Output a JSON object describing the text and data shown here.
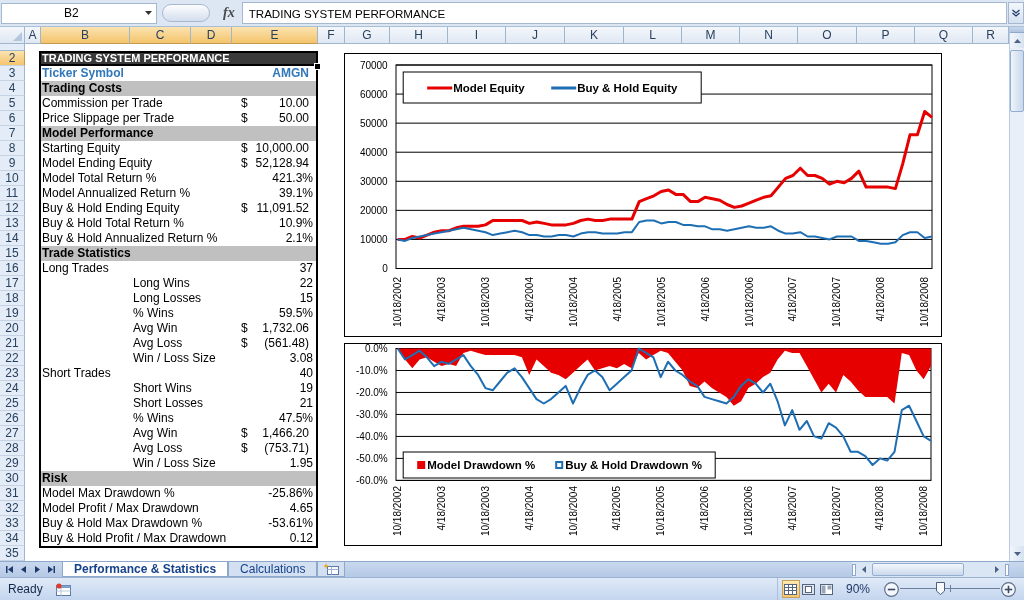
{
  "formula_bar": {
    "name_box": "B2",
    "function_button": "fx",
    "formula": "TRADING SYSTEM PERFORMANCE"
  },
  "column_headers": [
    {
      "label": "A",
      "selected": false
    },
    {
      "label": "B",
      "selected": true
    },
    {
      "label": "C",
      "selected": true
    },
    {
      "label": "D",
      "selected": true
    },
    {
      "label": "E",
      "selected": true
    },
    {
      "label": "F",
      "selected": false
    },
    {
      "label": "G",
      "selected": false
    },
    {
      "label": "H",
      "selected": false
    },
    {
      "label": "I",
      "selected": false
    },
    {
      "label": "J",
      "selected": false
    },
    {
      "label": "K",
      "selected": false
    },
    {
      "label": "L",
      "selected": false
    },
    {
      "label": "M",
      "selected": false
    },
    {
      "label": "N",
      "selected": false
    },
    {
      "label": "O",
      "selected": false
    },
    {
      "label": "P",
      "selected": false
    },
    {
      "label": "Q",
      "selected": false
    },
    {
      "label": "R",
      "selected": false
    }
  ],
  "row_headers": [
    {
      "label": "2",
      "selected": true
    },
    {
      "label": "3",
      "selected": false
    },
    {
      "label": "4",
      "selected": false
    },
    {
      "label": "5",
      "selected": false
    },
    {
      "label": "6",
      "selected": false
    },
    {
      "label": "7",
      "selected": false
    },
    {
      "label": "8",
      "selected": false
    },
    {
      "label": "9",
      "selected": false
    },
    {
      "label": "10",
      "selected": false
    },
    {
      "label": "11",
      "selected": false
    },
    {
      "label": "12",
      "selected": false
    },
    {
      "label": "13",
      "selected": false
    },
    {
      "label": "14",
      "selected": false
    },
    {
      "label": "15",
      "selected": false
    },
    {
      "label": "16",
      "selected": false
    },
    {
      "label": "17",
      "selected": false
    },
    {
      "label": "18",
      "selected": false
    },
    {
      "label": "19",
      "selected": false
    },
    {
      "label": "20",
      "selected": false
    },
    {
      "label": "21",
      "selected": false
    },
    {
      "label": "22",
      "selected": false
    },
    {
      "label": "23",
      "selected": false
    },
    {
      "label": "24",
      "selected": false
    },
    {
      "label": "25",
      "selected": false
    },
    {
      "label": "26",
      "selected": false
    },
    {
      "label": "27",
      "selected": false
    },
    {
      "label": "28",
      "selected": false
    },
    {
      "label": "29",
      "selected": false
    },
    {
      "label": "30",
      "selected": false
    },
    {
      "label": "31",
      "selected": false
    },
    {
      "label": "32",
      "selected": false
    },
    {
      "label": "33",
      "selected": false
    },
    {
      "label": "34",
      "selected": false
    },
    {
      "label": "35",
      "selected": false
    }
  ],
  "table": {
    "title": {
      "text": "TRADING SYSTEM PERFORMANCE",
      "selected": true
    },
    "rows": [
      {
        "kind": "ticker",
        "label": "Ticker Symbol",
        "value": "AMGN"
      },
      {
        "kind": "section",
        "label": "Trading Costs"
      },
      {
        "kind": "item",
        "label": "Commission per Trade",
        "currency": "$",
        "value": "10.00"
      },
      {
        "kind": "item",
        "label": "Price Slippage per Trade",
        "currency": "$",
        "value": "50.00"
      },
      {
        "kind": "section",
        "label": "Model Performance"
      },
      {
        "kind": "item",
        "label": "Starting Equity",
        "currency": "$",
        "value": "10,000.00"
      },
      {
        "kind": "item",
        "label": "Model Ending Equity",
        "currency": "$",
        "value": "52,128.94"
      },
      {
        "kind": "item",
        "label": "Model Total Return %",
        "value": "421.3%"
      },
      {
        "kind": "item",
        "label": "Model Annualized Return %",
        "value": "39.1%"
      },
      {
        "kind": "item",
        "label": "Buy & Hold Ending Equity",
        "currency": "$",
        "value": "11,091.52"
      },
      {
        "kind": "item",
        "label": "Buy & Hold Total Return %",
        "value": "10.9%"
      },
      {
        "kind": "item",
        "label": "Buy & Hold Annualized Return %",
        "value": "2.1%"
      },
      {
        "kind": "section",
        "label": "Trade Statistics"
      },
      {
        "kind": "item",
        "label": "Long Trades",
        "value": "37",
        "children": [
          {
            "kind": "item",
            "label": "Long Wins",
            "value": "22"
          },
          {
            "kind": "item",
            "label": "Long Losses",
            "value": "15"
          },
          {
            "kind": "item",
            "label": "% Wins",
            "value": "59.5%"
          },
          {
            "kind": "item",
            "label": "Avg Win",
            "currency": "$",
            "value": "1,732.06"
          },
          {
            "kind": "item",
            "label": "Avg Loss",
            "currency": "$",
            "value": "(561.48)"
          },
          {
            "kind": "item",
            "label": "Win / Loss Size",
            "value": "3.08"
          }
        ]
      },
      {
        "kind": "item",
        "label": "Short Trades",
        "value": "40",
        "children": [
          {
            "kind": "item",
            "label": "Short Wins",
            "value": "19"
          },
          {
            "kind": "item",
            "label": "Short Losses",
            "value": "21"
          },
          {
            "kind": "item",
            "label": "% Wins",
            "value": "47.5%"
          },
          {
            "kind": "item",
            "label": "Avg Win",
            "currency": "$",
            "value": "1,466.20"
          },
          {
            "kind": "item",
            "label": "Avg Loss",
            "currency": "$",
            "value": "(753.71)"
          },
          {
            "kind": "item",
            "label": "Win / Loss Size",
            "value": "1.95"
          }
        ]
      },
      {
        "kind": "section",
        "label": "Risk"
      },
      {
        "kind": "item",
        "label": "Model Max Drawdown %",
        "value": "-25.86%"
      },
      {
        "kind": "item",
        "label": "Model Profit / Max Drawdown",
        "value": "4.65"
      },
      {
        "kind": "item",
        "label": "Buy & Hold Max Drawdown %",
        "value": "-53.61%"
      },
      {
        "kind": "item",
        "label": "Buy & Hold Profit / Max Drawdown",
        "value": "0.12"
      }
    ]
  },
  "charts": [
    {
      "chart_data": {
        "type": "line",
        "categories": [
          "10/18/2002",
          null,
          null,
          null,
          null,
          null,
          "4/18/2003",
          null,
          null,
          null,
          null,
          null,
          "10/18/2003",
          null,
          null,
          null,
          null,
          null,
          "4/18/2004",
          null,
          null,
          null,
          null,
          null,
          "10/18/2004",
          null,
          null,
          null,
          null,
          null,
          "4/18/2005",
          null,
          null,
          null,
          null,
          null,
          "10/18/2005",
          null,
          null,
          null,
          null,
          null,
          "4/18/2006",
          null,
          null,
          null,
          null,
          null,
          "10/18/2006",
          null,
          null,
          null,
          null,
          null,
          "4/18/2007",
          null,
          null,
          null,
          null,
          null,
          "10/18/2007",
          null,
          null,
          null,
          null,
          null,
          "4/18/2008",
          null,
          null,
          null,
          null,
          null,
          "10/18/2008",
          null
        ],
        "series": [
          {
            "name": "Model Equity",
            "color": "#e60000",
            "values": [
              10000,
              10000,
              11000,
              10500,
              11500,
              12500,
              13000,
              13000,
              14000,
              14500,
              14500,
              14500,
              15000,
              16500,
              16500,
              16500,
              16500,
              16500,
              15500,
              16000,
              15500,
              15000,
              15000,
              15000,
              15500,
              16500,
              17000,
              16500,
              16500,
              17000,
              17000,
              17000,
              17000,
              23000,
              24000,
              25000,
              26500,
              27000,
              25500,
              25500,
              23000,
              23000,
              24500,
              24000,
              23500,
              22000,
              21000,
              21500,
              22500,
              23500,
              24500,
              25000,
              28000,
              31000,
              32000,
              34500,
              32000,
              32000,
              31000,
              29000,
              30000,
              29500,
              31000,
              33500,
              28000,
              28000,
              28000,
              28000,
              27500,
              36000,
              46000,
              46000,
              54000,
              52000
            ]
          },
          {
            "name": "Buy & Hold Equity",
            "color": "#1e6eb4",
            "values": [
              10000,
              9500,
              10500,
              11000,
              11500,
              12000,
              12500,
              13000,
              13500,
              14000,
              13500,
              13000,
              12500,
              11500,
              12000,
              12500,
              13000,
              12500,
              11500,
              11500,
              11000,
              11000,
              11500,
              11500,
              11000,
              12000,
              12500,
              12500,
              12000,
              12000,
              12000,
              12500,
              12500,
              16000,
              16500,
              16500,
              15500,
              16000,
              16000,
              15000,
              15000,
              14500,
              14500,
              13500,
              13500,
              13000,
              13500,
              14000,
              14500,
              14000,
              14000,
              14500,
              13000,
              12000,
              12000,
              12500,
              11000,
              11000,
              10500,
              10000,
              11000,
              11000,
              11000,
              9500,
              9500,
              9000,
              8500,
              8500,
              9000,
              11500,
              12500,
              12500,
              10500,
              11000
            ]
          }
        ],
        "ylim": [
          0,
          70000
        ],
        "yticks": [
          0,
          10000,
          20000,
          30000,
          40000,
          50000,
          60000,
          70000
        ],
        "grid": true,
        "legend": "top-left"
      }
    },
    {
      "chart_data": {
        "type": "area",
        "categories": [
          "10/18/2002",
          null,
          null,
          null,
          null,
          null,
          "4/18/2003",
          null,
          null,
          null,
          null,
          null,
          "10/18/2003",
          null,
          null,
          null,
          null,
          null,
          "4/18/2004",
          null,
          null,
          null,
          null,
          null,
          "10/18/2004",
          null,
          null,
          null,
          null,
          null,
          "4/18/2005",
          null,
          null,
          null,
          null,
          null,
          "10/18/2005",
          null,
          null,
          null,
          null,
          null,
          "4/18/2006",
          null,
          null,
          null,
          null,
          null,
          "10/18/2006",
          null,
          null,
          null,
          null,
          null,
          "4/18/2007",
          null,
          null,
          null,
          null,
          null,
          "10/18/2007",
          null,
          null,
          null,
          null,
          null,
          "4/18/2008",
          null,
          null,
          null,
          null,
          null,
          "10/18/2008",
          null
        ],
        "series": [
          {
            "name": "Model Drawdown %",
            "color": "#e60000",
            "type": "area",
            "values": [
              0,
              -5,
              -9,
              -5,
              -4,
              -6,
              -8,
              -7,
              -8,
              -2,
              -1,
              -2,
              -3,
              -3,
              -3,
              -3,
              -3,
              -4,
              -12,
              -5,
              -8,
              -11,
              -12,
              -14,
              -11,
              -8,
              -5,
              -10,
              -9,
              -8,
              -9,
              -7,
              -9,
              -2,
              -5,
              -3,
              -1,
              -2,
              -6,
              -10,
              -17,
              -18,
              -15,
              -18,
              -20,
              -22,
              -26,
              -24,
              -18,
              -16,
              -13,
              -11,
              -5,
              -1,
              -2,
              -2,
              -8,
              -14,
              -20,
              -16,
              -20,
              -12,
              -15,
              -19,
              -22,
              -22,
              -22,
              -22,
              -25,
              -2,
              -3,
              -10,
              -14,
              -8
            ]
          },
          {
            "name": "Buy & Hold Drawdown %",
            "color": "#1e6eb4",
            "type": "line",
            "values": [
              0,
              -5,
              -3,
              -1,
              -4,
              -8,
              -6,
              -7,
              -5,
              -3,
              -8,
              -12,
              -18,
              -19,
              -15,
              -11,
              -9,
              -13,
              -18,
              -23,
              -25,
              -23,
              -20,
              -17,
              -25,
              -18,
              -12,
              -10,
              -13,
              -19,
              -16,
              -13,
              -10,
              0,
              -2,
              -4,
              -13,
              -6,
              -10,
              -12,
              -15,
              -17,
              -22,
              -23,
              -24,
              -25,
              -22,
              -17,
              -14,
              -16,
              -20,
              -16,
              -24,
              -35,
              -28,
              -37,
              -33,
              -40,
              -41,
              -34,
              -36,
              -40,
              -47,
              -47,
              -49,
              -53,
              -50,
              -51,
              -47,
              -28,
              -26,
              -33,
              -40,
              -42
            ]
          }
        ],
        "ylim": [
          -60,
          0
        ],
        "yticks": [
          {
            "value": 0,
            "label": "0.0%"
          },
          {
            "value": -10,
            "label": "-10.0%"
          },
          {
            "value": -20,
            "label": "-20.0%"
          },
          {
            "value": -30,
            "label": "-30.0%"
          },
          {
            "value": -40,
            "label": "-40.0%"
          },
          {
            "value": -50,
            "label": "-50.0%"
          },
          {
            "value": -60,
            "label": "-60.0%"
          }
        ],
        "grid": true,
        "legend": "bottom-left"
      }
    }
  ],
  "sheet_tabs": [
    {
      "label": "Performance & Statistics",
      "selected": true
    },
    {
      "label": "Calculations",
      "selected": false
    }
  ],
  "status_bar": {
    "status": "Ready",
    "views": [
      {
        "kind": "normal",
        "selected": true
      },
      {
        "kind": "page_layout",
        "selected": false
      },
      {
        "kind": "page_break",
        "selected": false
      }
    ],
    "zoom": {
      "reading": "90%",
      "level": 0.4
    }
  }
}
